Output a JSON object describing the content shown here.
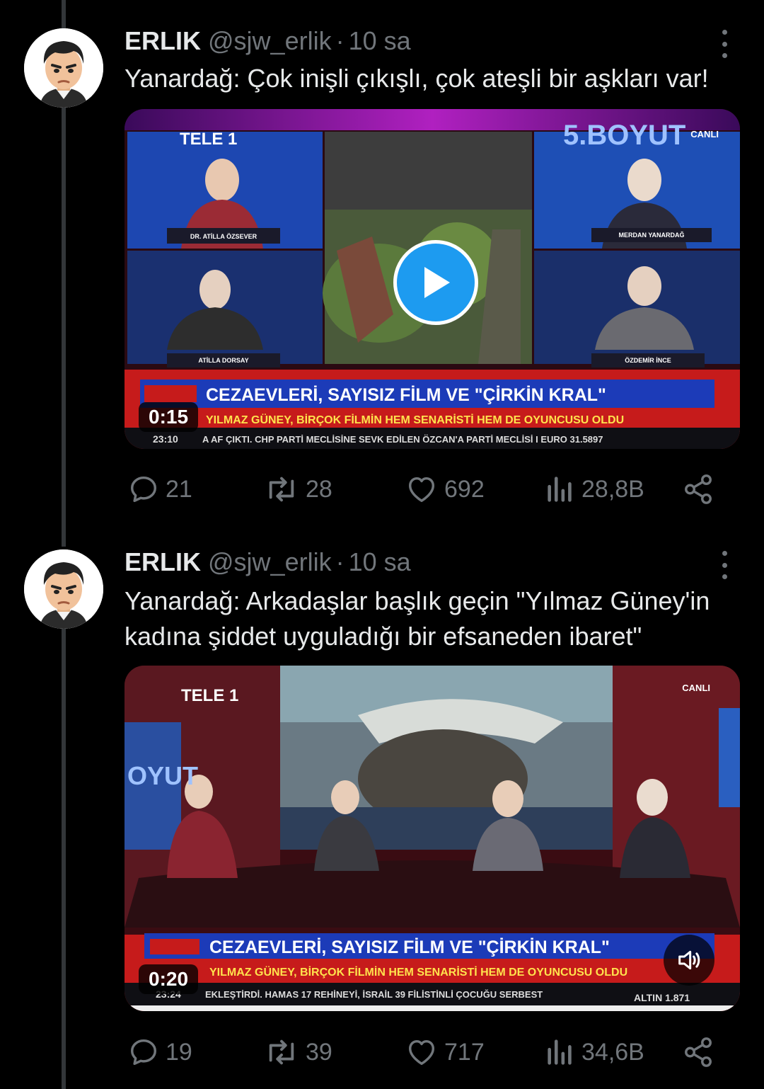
{
  "tweets": [
    {
      "name": "ERLIK",
      "handle": "@sjw_erlik",
      "separator": "·",
      "time": "10 sa",
      "text": "Yanardağ: Çok inişli çıkışlı, çok ateşli bir aşkları var!",
      "video": {
        "duration": "0:15",
        "channel_logo": "TELE 1",
        "live_badge": "CANLI",
        "show_title": "5.BOYUT",
        "headline": "CEZAEVLERİ, SAYISIZ FİLM VE \"ÇİRKİN KRAL\"",
        "subline": "YILMAZ GÜNEY, BİRÇOK FİLMİN HEM SENARİSTİ HEM DE OYUNCUSU OLDU",
        "ticker_time": "23:10",
        "ticker": "A AF ÇIKTI. CHP PARTİ MECLİSİNE SEVK EDİLEN ÖZCAN'A PARTİ MECLİSİ I EURO 31.5897",
        "guest_1": "DR. ATİLLA ÖZSEVER",
        "guest_2": "ATİLLA DORSAY",
        "guest_3": "MERDAN YANARDAĞ",
        "guest_4": "ÖZDEMİR İNCE"
      },
      "stats": {
        "replies": "21",
        "retweets": "28",
        "likes": "692",
        "views": "28,8B"
      }
    },
    {
      "name": "ERLIK",
      "handle": "@sjw_erlik",
      "separator": "·",
      "time": "10 sa",
      "text": "Yanardağ: Arkadaşlar başlık geçin \"Yılmaz Güney'in kadına şiddet uyguladığı bir efsaneden ibaret\"",
      "video": {
        "duration": "0:20",
        "channel_logo": "TELE 1",
        "live_badge": "CANLI",
        "show_title": "OYUT",
        "headline": "CEZAEVLERİ, SAYISIZ FİLM VE \"ÇİRKİN KRAL\"",
        "subline": "YILMAZ GÜNEY, BİRÇOK FİLMİN HEM SENARİSTİ HEM DE OYUNCUSU OLDU",
        "ticker_time": "23:24",
        "ticker": "EKLEŞTİRDİ. HAMAS 17 REHİNEYİ, İSRAİL 39 FİLİSTİNLİ ÇOCUĞU SERBEST",
        "ticker_right": "ALTIN 1.871"
      },
      "stats": {
        "replies": "19",
        "retweets": "39",
        "likes": "717",
        "views": "34,6B"
      }
    }
  ],
  "icons": [
    "reply-icon",
    "retweet-icon",
    "like-icon",
    "views-icon",
    "share-icon",
    "play-icon",
    "volume-icon",
    "more-icon"
  ],
  "colors": {
    "background": "#000000",
    "text": "#e7e9ea",
    "muted": "#71767b",
    "accent": "#1d9bf0",
    "thread_line": "#333639"
  }
}
